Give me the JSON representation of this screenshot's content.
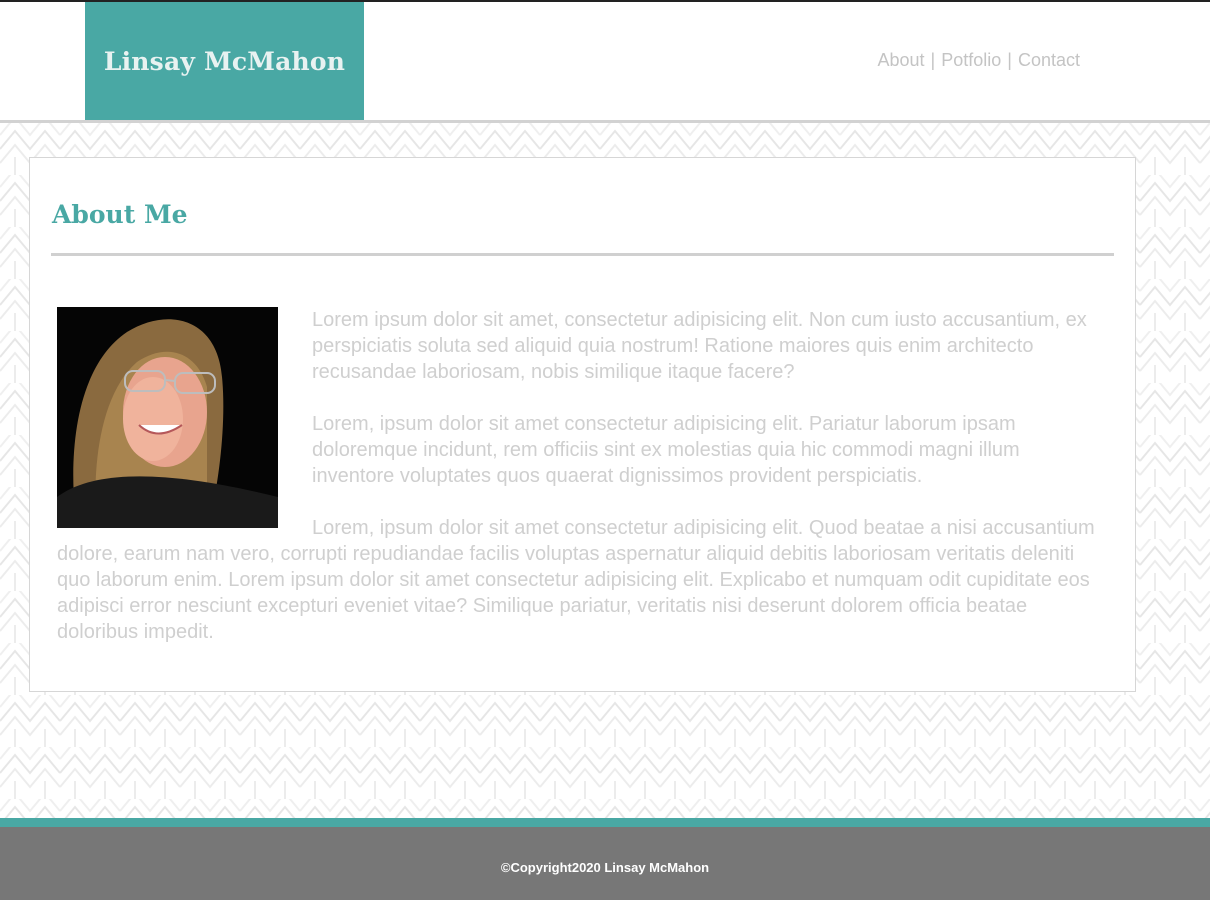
{
  "site": {
    "brand": "Linsay McMahon",
    "nav": [
      {
        "label": "About"
      },
      {
        "label": "Potfolio"
      },
      {
        "label": "Contact"
      }
    ],
    "nav_separator": "|"
  },
  "about": {
    "heading": "About Me",
    "photo_alt": "portrait photo",
    "paragraphs": [
      "Lorem ipsum dolor sit amet, consectetur adipisicing elit. Non cum iusto accusantium, ex perspiciatis soluta sed aliquid quia nostrum! Ratione maiores quis enim architecto recusandae laboriosam, nobis similique itaque facere?",
      "Lorem, ipsum dolor sit amet consectetur adipisicing elit. Pariatur laborum ipsam doloremque incidunt, rem officiis sint ex molestias quia hic commodi magni illum inventore voluptates quos quaerat dignissimos provident perspiciatis.",
      "Lorem, ipsum dolor sit amet consectetur adipisicing elit. Quod beatae a nisi accusantium dolore, earum nam vero, corrupti repudiandae facilis voluptas aspernatur aliquid debitis laboriosam veritatis deleniti quo laborum enim. Lorem ipsum dolor sit amet consectetur adipisicing elit. Explicabo et numquam odit cupiditate eos adipisci error nesciunt excepturi eveniet vitae? Similique pariatur, veritatis nisi deserunt dolorem officia beatae doloribus impedit."
    ]
  },
  "footer": {
    "copyright": "©Copyright2020 Linsay McMahon"
  },
  "colors": {
    "accent": "#49a8a4",
    "footer_bg": "#777777",
    "text_muted": "#cfcfcf"
  }
}
